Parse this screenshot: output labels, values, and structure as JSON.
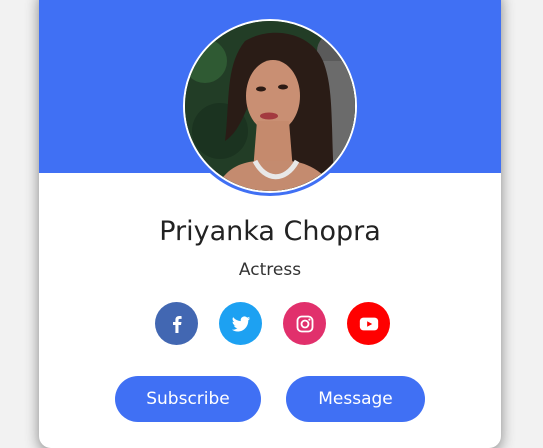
{
  "profile": {
    "name": "Priyanka Chopra",
    "title": "Actress"
  },
  "socials": [
    {
      "icon": "facebook-icon",
      "color": "#4267b2"
    },
    {
      "icon": "twitter-icon",
      "color": "#1da1f2"
    },
    {
      "icon": "instagram-icon",
      "color": "#e1306c"
    },
    {
      "icon": "youtube-icon",
      "color": "#ff0000"
    }
  ],
  "actions": {
    "subscribe_label": "Subscribe",
    "message_label": "Message"
  },
  "colors": {
    "accent": "#4070f4",
    "card_background": "#ffffff"
  }
}
